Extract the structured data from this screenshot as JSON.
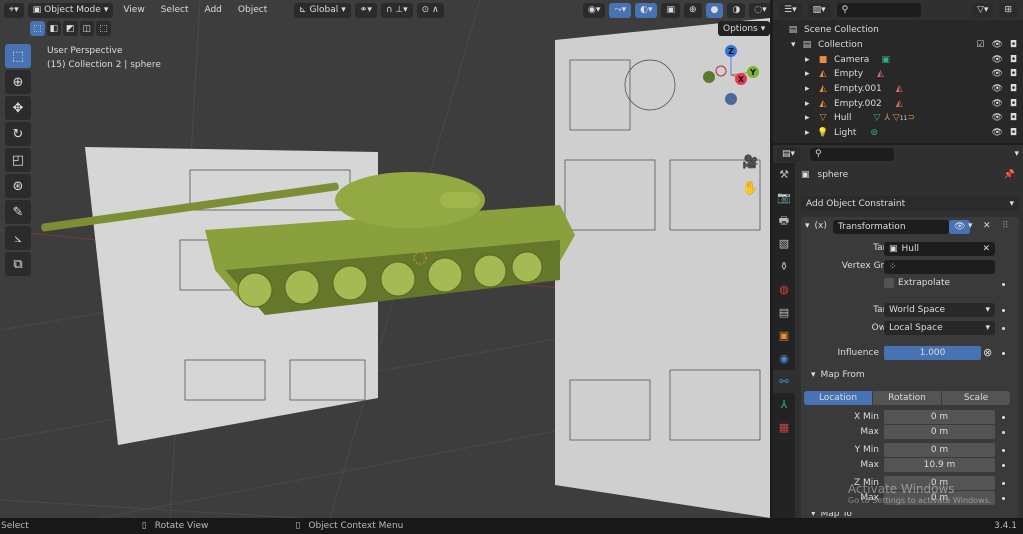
{
  "viewport": {
    "mode": "Object Mode",
    "menus": [
      "View",
      "Select",
      "Add",
      "Object"
    ],
    "transform_orientation": "Global",
    "overlay_text": {
      "line1": "User Perspective",
      "line2": "(15) Collection 2 | sphere"
    },
    "options_label": "Options",
    "gizmo": {
      "z": "Z",
      "y": "Y",
      "x": "X"
    },
    "tools": [
      "select-box",
      "cursor",
      "move",
      "rotate",
      "scale",
      "transform",
      "annotate",
      "measure",
      "add-cube"
    ]
  },
  "outliner": {
    "root": "Scene Collection",
    "collection": "Collection",
    "items": [
      {
        "name": "Camera",
        "icon": "camera-icon"
      },
      {
        "name": "Empty",
        "icon": "empty-image-icon"
      },
      {
        "name": "Empty.001",
        "icon": "empty-image-icon"
      },
      {
        "name": "Empty.002",
        "icon": "empty-image-icon"
      },
      {
        "name": "Hull",
        "icon": "mesh-icon",
        "badge": "11"
      },
      {
        "name": "Light",
        "icon": "light-icon"
      }
    ]
  },
  "properties": {
    "object_name": "sphere",
    "add_constraint": "Add Object Constraint",
    "constraint": {
      "name": "Transformation",
      "prefix": "(x)",
      "target_label": "Target",
      "target": "Hull",
      "vertex_group_label": "Vertex Group",
      "extrapolate": "Extrapolate",
      "target_space_label": "Target",
      "target_space": "World Space",
      "owner_space_label": "Owner",
      "owner_space": "Local Space",
      "influence_label": "Influence",
      "influence": "1.000",
      "map_from": "Map From",
      "tabs": [
        "Location",
        "Rotation",
        "Scale"
      ],
      "active_tab": "Location",
      "rows": [
        {
          "label": "X Min",
          "value": "0 m"
        },
        {
          "label": "Max",
          "value": "0 m"
        },
        {
          "label": "Y Min",
          "value": "0 m"
        },
        {
          "label": "Max",
          "value": "10.9 m"
        },
        {
          "label": "Z Min",
          "value": "0 m"
        },
        {
          "label": "Max",
          "value": "0 m"
        }
      ],
      "map_to": "Map To"
    }
  },
  "watermark": {
    "title": "Activate Windows",
    "subtitle": "Go to Settings to activate Windows."
  },
  "status": {
    "select": "Select",
    "rotate": "Rotate View",
    "context": "Object Context Menu",
    "version": "3.4.1"
  }
}
